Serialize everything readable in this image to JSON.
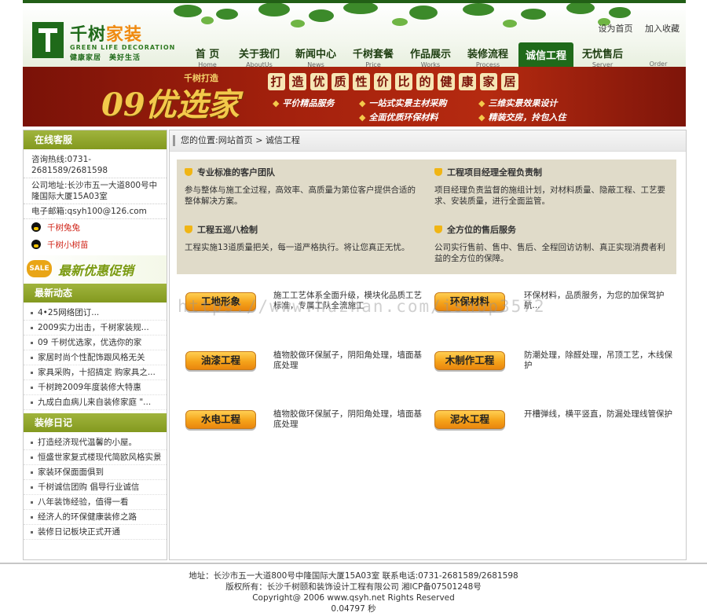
{
  "header": {
    "logo_cn_a": "千树",
    "logo_cn_b": "家装",
    "logo_en": "GREEN LIFE DECORATION",
    "logo_sub": "健康家居　美好生活",
    "toplinks": [
      "设为首页",
      "加入收藏"
    ]
  },
  "nav": [
    {
      "cn": "首 页",
      "en": "Home"
    },
    {
      "cn": "关于我们",
      "en": "AboutUs"
    },
    {
      "cn": "新闻中心",
      "en": "News"
    },
    {
      "cn": "千树套餐",
      "en": "Price"
    },
    {
      "cn": "作品展示",
      "en": "Works"
    },
    {
      "cn": "装修流程",
      "en": "Process"
    },
    {
      "cn": "诚信工程",
      "en": ""
    },
    {
      "cn": "无忧售后",
      "en": "Server"
    },
    {
      "cn": "",
      "en": "Order"
    }
  ],
  "banner": {
    "small": "千树打造",
    "big": "09优选家",
    "slogan": [
      "打",
      "造",
      "优",
      "质",
      "性",
      "价",
      "比",
      "的",
      "健",
      "康",
      "家",
      "居"
    ],
    "lines": [
      "平价精品服务",
      "一站式实景主材采购",
      "三维实景效果设计",
      "全面优质环保材料",
      "精装交房，拎包入住"
    ]
  },
  "sidebar": {
    "online_title": "在线客服",
    "hotline": "咨询热线:0731-2681589/2681598",
    "address": "公司地址:长沙市五一大道800号中隆国际大厦15A03室",
    "email": "电子邮箱:qsyh100@126.com",
    "qq": [
      "千树兔兔",
      "千树小树苗"
    ],
    "promo_badge": "SALE",
    "promo_text": "最新优惠促销",
    "news_title": "最新动态",
    "news": [
      "4•25网络团订...",
      "2009实力出击，千树家装规...",
      "09 千树优选家，优选你的家",
      "家居时尚个性配饰跟风格无关",
      "家具采购，十招搞定 购家具之...",
      "千树跨2009年度装修大特惠",
      "九成白血病儿来自装修家庭 \"..."
    ],
    "diary_title": "装修日记",
    "diary": [
      "打造经济现代温馨的小屋。",
      "恒盛世家复式楼现代简欧风格实景",
      "家装环保面面俱到",
      "千树诚信团购 倡导行业诚信",
      "八年装饰经验，值得一看",
      "经济人的环保健康装修之路",
      "装修日记板块正式开通"
    ]
  },
  "main": {
    "crumb_prefix": "您的位置:",
    "crumb_home": "网站首页",
    "crumb_sep": " > ",
    "crumb_current": "诚信工程",
    "info": [
      {
        "title": "专业标准的客户团队",
        "desc": "参与整体与施工全过程，高效率、高质量为第位客户提供合适的整体解决方案。"
      },
      {
        "title": "工程项目经理全程负责制",
        "desc": "项目经理负责监督的施组计划，对材料质量、隐蔽工程、工艺要求、安装质量，进行全面监管。"
      },
      {
        "title": "工程五巡八检制",
        "desc": "工程实施13道质量把关，每一道严格执行。将让您真正无忧。"
      },
      {
        "title": "全方位的售后服务",
        "desc": "公司实行售前、售中、售后、全程回访访制、真正实现消费者利益的全方位的保障。"
      }
    ],
    "services": [
      {
        "label": "工地形象",
        "desc": "施工工艺体系全面升级，模块化品质工艺标准，专属工队全流施工"
      },
      {
        "label": "环保材料",
        "desc": "环保材料，品质服务，为您的加保驾护航..."
      },
      {
        "label": "油漆工程",
        "desc": "植物胶做环保腻子，阴阳角处理，墙面基底处理"
      },
      {
        "label": "木制作工程",
        "desc": "防潮处理，除醛处理，吊顶工艺，木线保护"
      },
      {
        "label": "水电工程",
        "desc": "植物胶做环保腻子，阴阳角处理，墙面基底处理"
      },
      {
        "label": "泥水工程",
        "desc": "开槽弹线，横平竖直，防漏处理线管保护"
      }
    ],
    "watermark": "https://www.huzhan.com/ishop3572"
  },
  "footer": {
    "line1": "地址：长沙市五一大道800号中隆国际大厦15A03室 联系电话:0731-2681589/2681598",
    "line2": "版权所有：长沙千树颐和装饰设计工程有限公司 湘ICP备07501248号",
    "line3": "Copyright@ 2006 www.qsyh.net Rights Reserved",
    "line4": "0.04797 秒"
  },
  "colors": {
    "green": "#225f16",
    "olive": "#8ea12a",
    "orange": "#f5a31a",
    "banner": "#a4210d"
  }
}
